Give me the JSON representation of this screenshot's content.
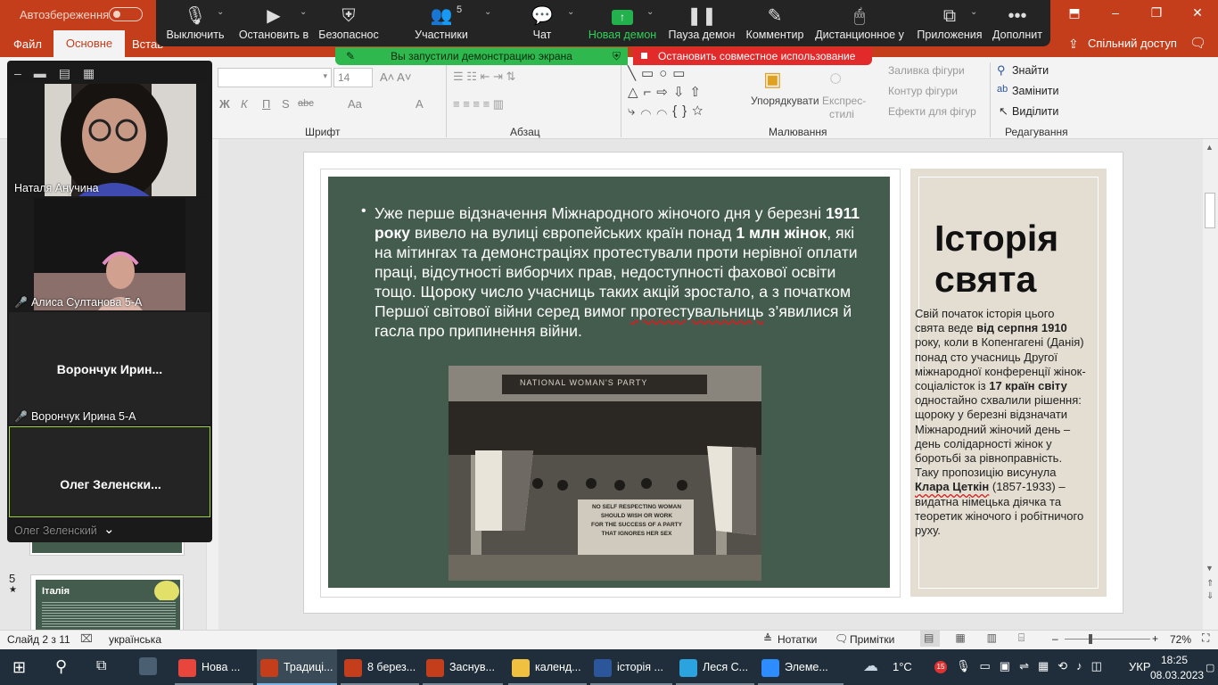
{
  "titlebar": {
    "autosave_label": "Автозбереження",
    "minimize": "–",
    "restore": "❐",
    "close": "✕"
  },
  "ribbon_tabs": {
    "file": "Файл",
    "home": "Основне",
    "insert": "Встав",
    "share": "Спільний доступ"
  },
  "zoom_toolbar": {
    "mute": "Выключить",
    "video": "Остановить в",
    "security": "Безопаснос",
    "participants": "Участники",
    "participants_count": "5",
    "chat": "Чат",
    "new_share": "Новая демон",
    "pause_share": "Пауза демон",
    "annotate": "Комментир",
    "remote": "Дистанционное у",
    "apps": "Приложения",
    "more": "Дополнит"
  },
  "share_notice": {
    "green": "Вы запустили демонстрацию экрана",
    "red": "Остановить совместное использование"
  },
  "ribbon": {
    "font_size": "14",
    "font_group": "Шрифт",
    "paragraph_group": "Абзац",
    "drawing_group": "Малювання",
    "editing_group": "Редагування",
    "arrange": "Упорядкувати",
    "quick_styles_1": "Експрес-",
    "quick_styles_2": "стилі",
    "shape_fill": "Заливка фігури",
    "shape_outline": "Контур фігури",
    "shape_effects": "Ефекти для фігур",
    "find": "Знайти",
    "replace": "Замінити",
    "select": "Виділити",
    "bold": "Ж",
    "italic": "К",
    "underline": "П",
    "strike": "S",
    "abc": "abc",
    "aa": "Aa",
    "a": "A"
  },
  "gallery": {
    "p1_name": "Наталя Анучина",
    "p2_name": "Алиса Султанова 5-А",
    "p3_big": "Ворончук  Ирин...",
    "p3_name": "Ворончук Ирина 5-А",
    "p4_big": "Олег  Зеленски...",
    "p4_name": "Олег Зеленский"
  },
  "thumbnails": {
    "slide5_num": "5",
    "slide5_star": "★",
    "slide5_title": "Італія"
  },
  "slide": {
    "body_pre": "Уже перше відзначення Міжнародного жіночого дня у березні ",
    "body_b1": "1911 року",
    "body_mid1": " вивело на вулиці європейських країн понад ",
    "body_b2": "1 млн жінок",
    "body_mid2": ", які на мітингах та демонстраціях протестували проти нерівної оплати праці, відсутності виборчих прав, недоступності фахової освіти тощо. Щороку число учасниць таких акцій зростало, а з початком Першої світової війни серед вимог ",
    "body_sq": "протестувальниць",
    "body_end": " з’явилися й гасла про припинення війни.",
    "photo_banner": "NATIONAL WOMAN'S PARTY",
    "photo_sign_1": "NO SELF RESPECTING WOMAN",
    "photo_sign_2": "SHOULD WISH OR WORK",
    "photo_sign_3": "FOR THE SUCCESS OF A PARTY",
    "photo_sign_4": "THAT IGNORES HER SEX",
    "side_title_1": "Історія",
    "side_title_2": "свята",
    "side_pre": "Свій початок історія цього свята веде ",
    "side_b1": "від серпня 1910",
    "side_mid1": " року, коли в Копенгагені (Данія) понад сто учасниць Другої міжнародної конференції жінок-соціалісток із ",
    "side_b2": "17 країн світу",
    "side_mid2": " одностайно схвалили рішення: щороку у березні відзначати Міжнародний жіночий день – день солідарності жінок у боротьбі за рівноправність. Таку пропозицію висунула ",
    "side_b3": "Клара Цеткін",
    "side_end": " (1857-1933) – видатна німецька діячка та теоретик жіночого і робітничого руху."
  },
  "statusbar": {
    "slide_info": "Слайд 2 з 11",
    "language": "українська",
    "notes": "Нотатки",
    "comments": "Примітки",
    "zoom": "72%"
  },
  "taskbar": {
    "apps": [
      {
        "label": "Нова ...",
        "icon": "chrome-icon",
        "color": "#e8453c"
      },
      {
        "label": "Традиці...",
        "icon": "powerpoint-icon",
        "color": "#c43e1c"
      },
      {
        "label": "8 берез...",
        "icon": "powerpoint-icon",
        "color": "#c43e1c"
      },
      {
        "label": "Заснув...",
        "icon": "powerpoint-icon",
        "color": "#c43e1c"
      },
      {
        "label": "календ...",
        "icon": "folder-icon",
        "color": "#f0c040"
      },
      {
        "label": "історія ...",
        "icon": "word-icon",
        "color": "#2b579a"
      },
      {
        "label": "Леся С...",
        "icon": "telegram-icon",
        "color": "#2aa3de"
      },
      {
        "label": "Элеме...",
        "icon": "zoom-icon",
        "color": "#2d8cff"
      }
    ],
    "weather": "1°C",
    "badge_15": "15",
    "lang": "УКР",
    "time": "18:25",
    "date": "08.03.2023"
  }
}
